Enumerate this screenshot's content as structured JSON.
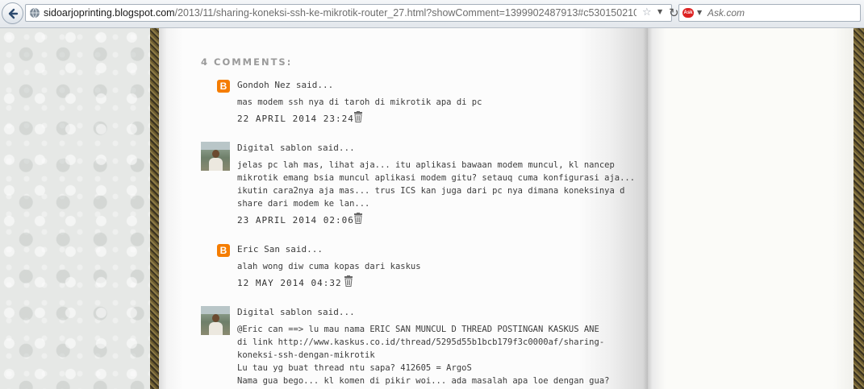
{
  "browser": {
    "url_host": "sidoarjoprinting.blogspot.com",
    "url_path": "/2013/11/sharing-koneksi-ssh-ke-mikrotik-router_27.html?showComment=1399902487913#c530150210376870",
    "search_placeholder": "Ask.com",
    "search_engine_badge": "ask",
    "icons": [
      "back-icon",
      "globe-icon",
      "bookmark-star-icon",
      "history-dropdown-icon",
      "reload-icon",
      "ask-logo-icon"
    ]
  },
  "comments": {
    "heading": "4 COMMENTS:",
    "items": [
      {
        "author": "Gondoh Nez said...",
        "avatar": "blogger-icon",
        "lines": [
          "mas modem ssh nya di taroh di mikrotik apa di pc"
        ],
        "timestamp": "22 APRIL 2014 23:24"
      },
      {
        "author": "Digital sablon said...",
        "avatar": "user-photo",
        "lines": [
          "jelas pc lah mas, lihat aja... itu aplikasi bawaan modem muncul, kl nancep",
          "mikrotik emang bsia muncul aplikasi modem gitu? setauq cuma konfigurasi aja...",
          "ikutin cara2nya aja mas... trus ICS kan juga dari pc nya dimana koneksinya d",
          "share dari modem ke lan..."
        ],
        "timestamp": "23 APRIL 2014 02:06"
      },
      {
        "author": "Eric San said...",
        "avatar": "blogger-icon",
        "lines": [
          "alah wong diw cuma kopas dari kaskus"
        ],
        "timestamp": "12 MAY 2014 04:32"
      },
      {
        "author": "Digital sablon said...",
        "avatar": "user-photo",
        "lines": [
          "@Eric can ==> lu mau nama ERIC SAN MUNCUL D THREAD POSTINGAN KASKUS ANE",
          "di link http://www.kaskus.co.id/thread/5295d55b1bcb179f3c0000af/sharing-",
          "koneksi-ssh-dengan-mikrotik",
          "Lu tau yg buat thread ntu sapa? 412605 = ArgoS",
          "Nama gua bego... kl komen di pikir woi... ada masalah apa loe dengan gua?"
        ]
      }
    ]
  },
  "colors": {
    "blogger_orange": "#f57d00",
    "text": "#3c3c3c",
    "heading": "#9a9a9a"
  }
}
